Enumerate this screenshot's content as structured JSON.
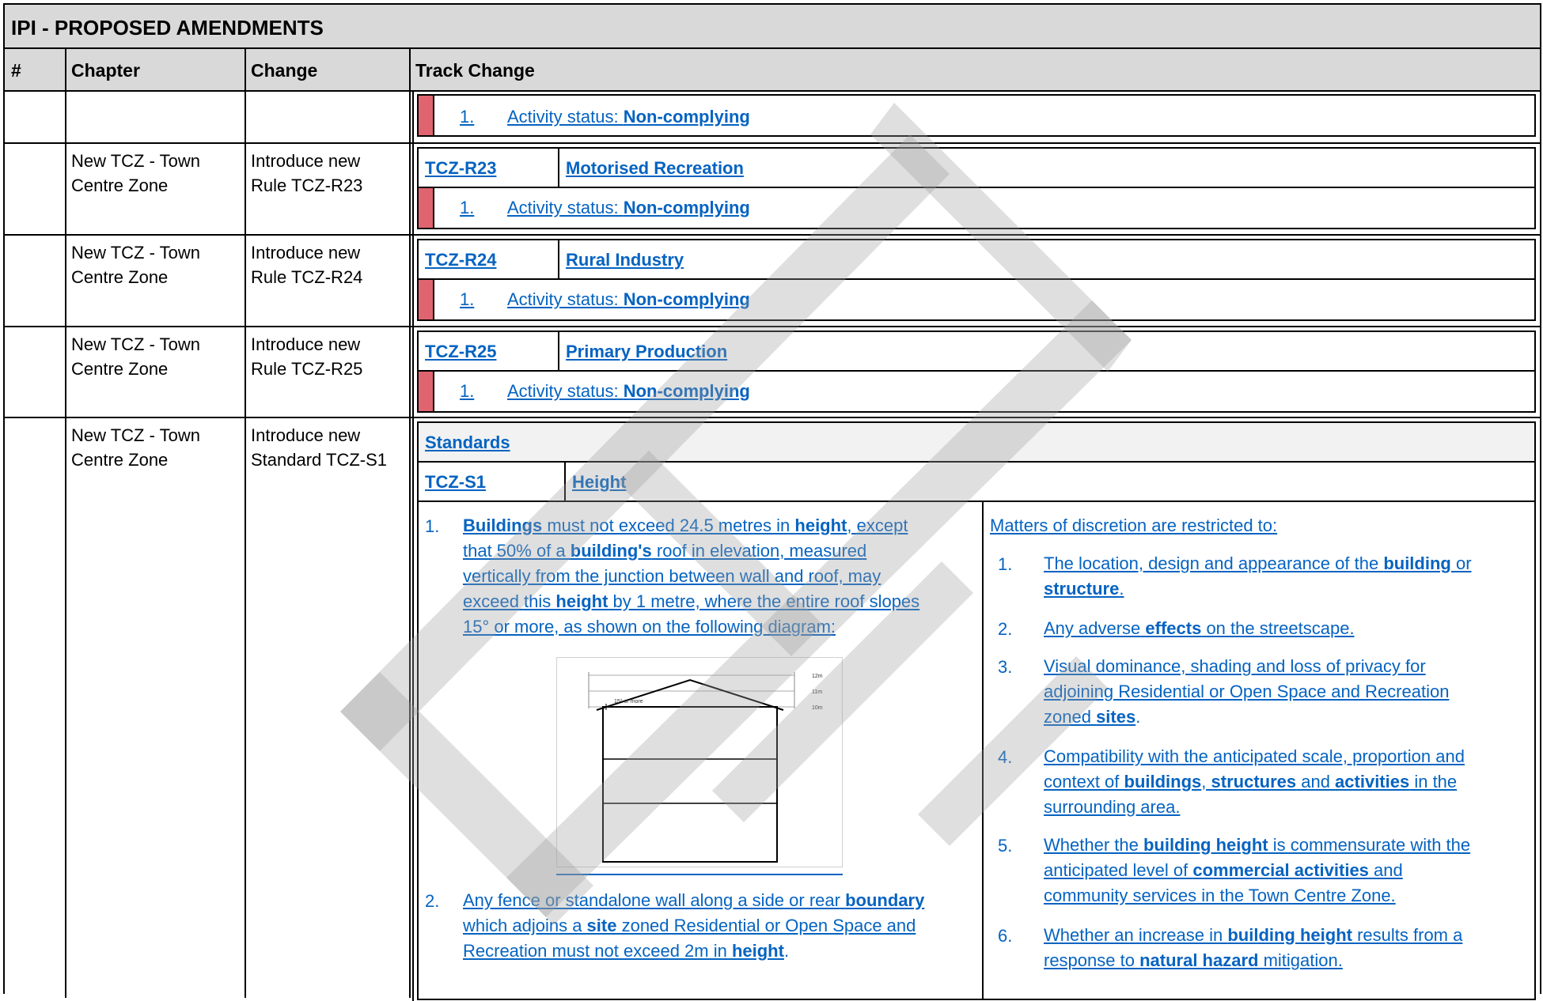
{
  "title": "IPI - PROPOSED AMENDMENTS",
  "columns": {
    "num": "#",
    "chapter": "Chapter",
    "change": "Change",
    "track": "Track Change"
  },
  "row0": {
    "status_prefix": "1.",
    "status_label": "Activity status: ",
    "status_value": "Non-complying"
  },
  "rules": [
    {
      "chapter_1": "New TCZ - Town",
      "chapter_2": "Centre Zone",
      "change_1": "Introduce new",
      "change_2": "Rule TCZ-R23",
      "code": "TCZ-R23",
      "name": "Motorised Recreation",
      "status_prefix": "1.",
      "status_label": "Activity status: ",
      "status_value": "Non-complying"
    },
    {
      "chapter_1": "New TCZ - Town",
      "chapter_2": "Centre Zone",
      "change_1": "Introduce new",
      "change_2": "Rule TCZ-R24",
      "code": "TCZ-R24",
      "name": "Rural Industry",
      "status_prefix": "1.",
      "status_label": "Activity status: ",
      "status_value": "Non-complying"
    },
    {
      "chapter_1": "New TCZ - Town",
      "chapter_2": "Centre Zone",
      "change_1": "Introduce new",
      "change_2": "Rule TCZ-R25",
      "code": "TCZ-R25",
      "name": "Primary Production",
      "status_prefix": "1.",
      "status_label": "Activity status: ",
      "status_value": "Non-complying"
    }
  ],
  "standard": {
    "chapter_1": "New TCZ - Town",
    "chapter_2": "Centre Zone",
    "change_1": "Introduce new",
    "change_2": "Standard TCZ-S1",
    "section": "Standards",
    "code": "TCZ-S1",
    "name": "Height",
    "left": {
      "p1_num": "1.",
      "p1_l1_a": "Buildings",
      "p1_l1_b": " must not exceed 24.5 metres in ",
      "p1_l1_c": "height",
      "p1_l1_d": ", except",
      "p1_l2_a": "that 50% of a ",
      "p1_l2_b": "building's",
      "p1_l2_c": " roof in elevation, measured",
      "p1_l3": "vertically from the junction between wall and roof, may",
      "p1_l4_a": "exceed this ",
      "p1_l4_b": "height",
      "p1_l4_c": " by 1 metre, where the entire roof slopes",
      "p1_l5": "15° or more, as shown on the following diagram:",
      "p2_num": "2.",
      "p2_l1_a": "Any fence or standalone wall along a side or rear ",
      "p2_l1_b": "boundary",
      "p2_l2_a": "which adjoins a ",
      "p2_l2_b": "site",
      "p2_l2_c": " zoned Residential or Open Space and",
      "p2_l3_a": "Recreation must not exceed 2m in ",
      "p2_l3_b": "height",
      "p2_l3_c": "."
    },
    "diagram": {
      "label_12": "12m",
      "label_11": "11m",
      "label_10": "10m",
      "angle_label": "15° or more"
    },
    "right": {
      "intro": "Matters of discretion are restricted to:",
      "i1_num": "1.",
      "i1_l1_a": "The location, design and appearance of the ",
      "i1_l1_b": "building",
      "i1_l1_c": " or",
      "i1_l2_a": "structure",
      "i1_l2_b": ".",
      "i2_num": "2.",
      "i2_l1_a": "Any adverse ",
      "i2_l1_b": "effects",
      "i2_l1_c": " on the streetscape.",
      "i3_num": "3.",
      "i3_l1": "Visual dominance, shading and loss of privacy for",
      "i3_l2": "adjoining Residential or Open Space and Recreation",
      "i3_l3_a": "zoned ",
      "i3_l3_b": "sites",
      "i3_l3_c": ".",
      "i4_num": "4.",
      "i4_l1": "Compatibility with the anticipated scale, proportion and",
      "i4_l2_a": "context of ",
      "i4_l2_b": "buildings",
      "i4_l2_c": ", ",
      "i4_l2_d": "structures",
      "i4_l2_e": " and ",
      "i4_l2_f": "activities",
      "i4_l2_g": " in the",
      "i4_l3": "surrounding area.",
      "i5_num": "5.",
      "i5_l1_a": "Whether the ",
      "i5_l1_b": "building height",
      "i5_l1_c": " is commensurate with the",
      "i5_l2_a": "anticipated level of ",
      "i5_l2_b": "commercial activities",
      "i5_l2_c": " and",
      "i5_l3": "community services in the Town Centre Zone.",
      "i6_num": "6.",
      "i6_l1_a": "Whether an increase in ",
      "i6_l1_b": "building height",
      "i6_l1_c": " results from a",
      "i6_l2_a": "response to ",
      "i6_l2_b": "natural hazard",
      "i6_l2_c": " mitigation."
    }
  },
  "watermark": "DRAFT"
}
